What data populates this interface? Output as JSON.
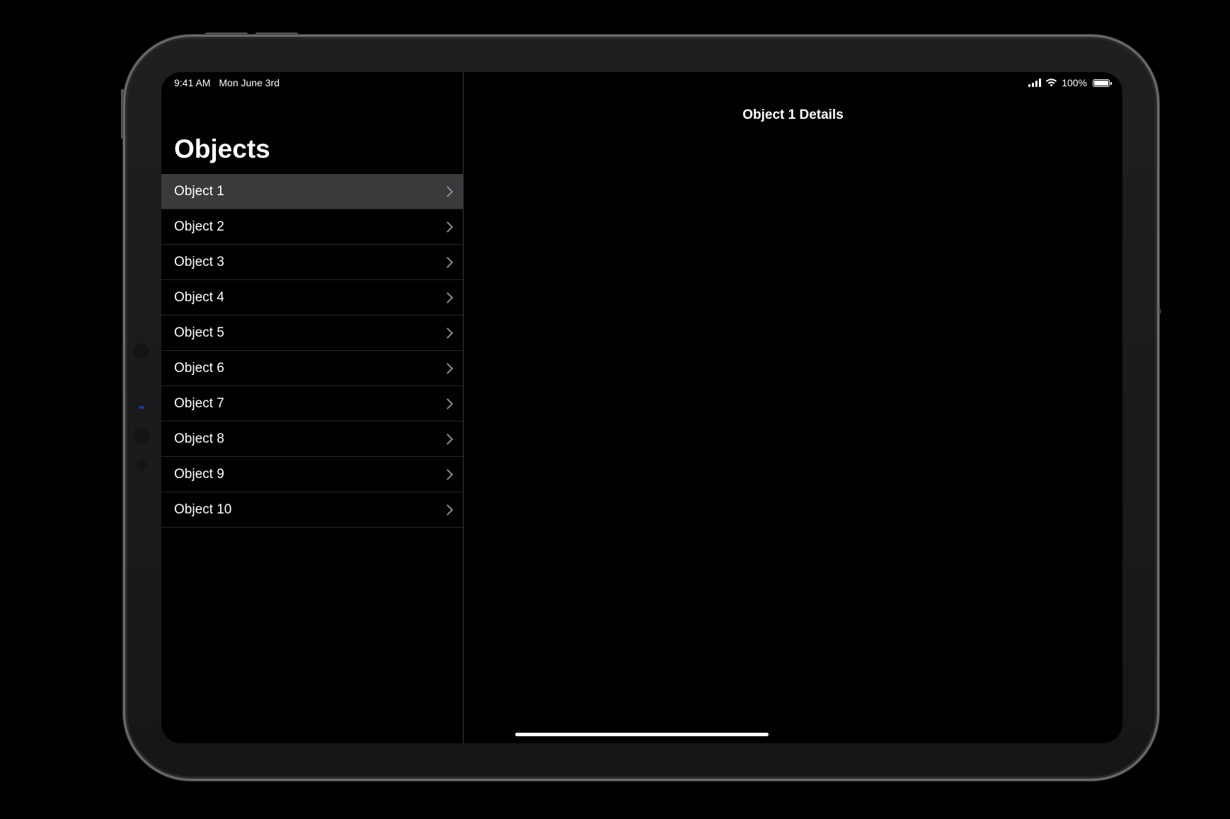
{
  "status_bar": {
    "time": "9:41 AM",
    "date": "Mon June 3rd",
    "battery": "100%",
    "signal_icon": "cellular-signal-icon",
    "wifi_icon": "wifi-icon",
    "battery_icon": "battery-icon",
    "battery_level": 1.0
  },
  "master": {
    "title": "Objects",
    "selected_index": 0,
    "items": [
      {
        "label": "Object 1"
      },
      {
        "label": "Object 2"
      },
      {
        "label": "Object 3"
      },
      {
        "label": "Object 4"
      },
      {
        "label": "Object 5"
      },
      {
        "label": "Object 6"
      },
      {
        "label": "Object 7"
      },
      {
        "label": "Object 8"
      },
      {
        "label": "Object 9"
      },
      {
        "label": "Object 10"
      }
    ],
    "disclosure_icon": "chevron-right-icon"
  },
  "detail": {
    "title": "Object 1 Details"
  },
  "colors": {
    "background": "#000000",
    "selected_row": "#3a3a3c",
    "separator": "#262628",
    "text": "#ffffff",
    "chevron": "#8e8e93"
  }
}
